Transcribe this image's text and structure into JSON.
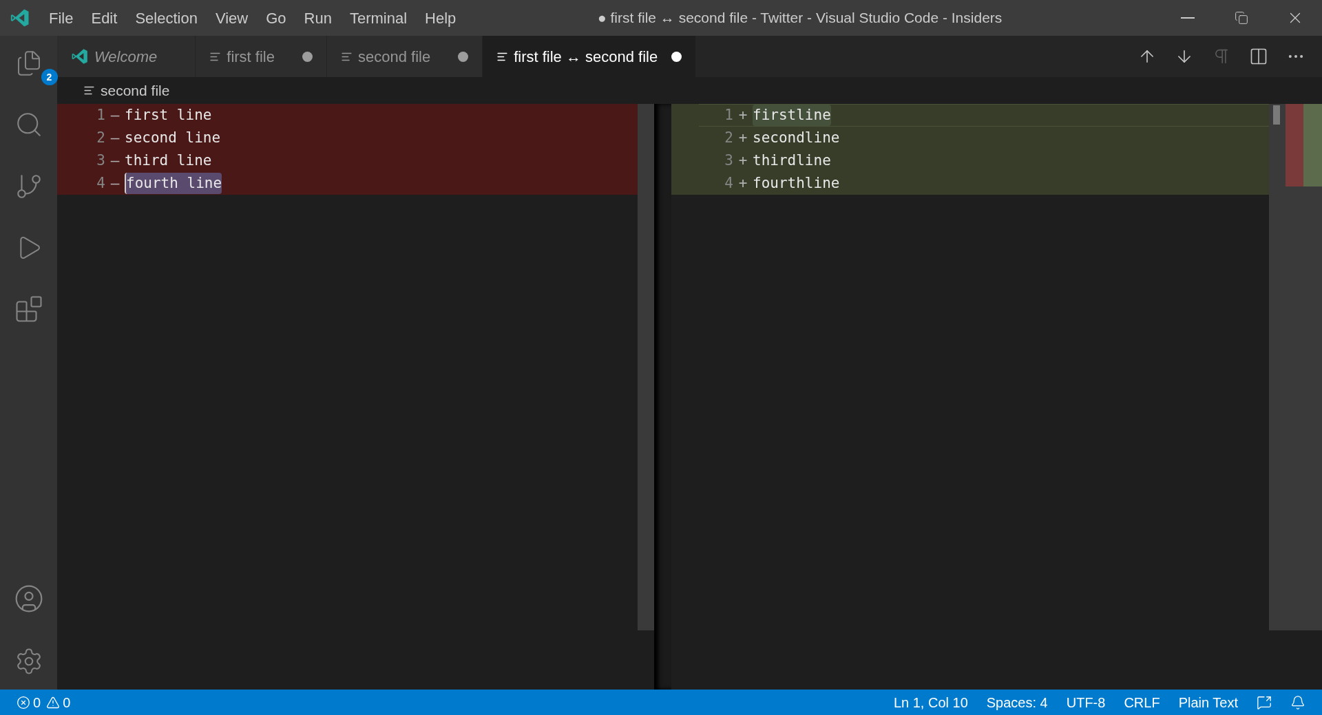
{
  "window": {
    "title": "● first file ↔ second file - Twitter - Visual Studio Code - Insiders"
  },
  "menu": [
    "File",
    "Edit",
    "Selection",
    "View",
    "Go",
    "Run",
    "Terminal",
    "Help"
  ],
  "activity_bar": {
    "explorer_badge": "2"
  },
  "tabs": [
    {
      "label": "Welcome",
      "kind": "welcome",
      "dirty": false,
      "selected": false
    },
    {
      "label": "first file",
      "kind": "file",
      "dirty": true,
      "selected": false
    },
    {
      "label": "second file",
      "kind": "file",
      "dirty": true,
      "selected": false
    },
    {
      "label": "first file ↔ second file",
      "kind": "diff",
      "dirty": true,
      "selected": true
    }
  ],
  "editor_actions": [
    {
      "kind": "up",
      "disabled": false
    },
    {
      "kind": "down",
      "disabled": false
    },
    {
      "kind": "whitespace",
      "disabled": true
    },
    {
      "kind": "split",
      "disabled": false
    },
    {
      "kind": "more",
      "disabled": false
    }
  ],
  "breadcrumb": "second file",
  "left_lines": [
    {
      "number": "1",
      "sign": "—",
      "text": "first line",
      "selected": false
    },
    {
      "number": "2",
      "sign": "—",
      "text": "second line",
      "selected": false
    },
    {
      "number": "3",
      "sign": "—",
      "text": "third line",
      "selected": false
    },
    {
      "number": "4",
      "sign": "—",
      "text": "fourth line",
      "selected": true
    }
  ],
  "right_lines": [
    {
      "number": "1",
      "sign": "+",
      "text": "firstline",
      "current": true
    },
    {
      "number": "2",
      "sign": "+",
      "text": "secondline",
      "current": false
    },
    {
      "number": "3",
      "sign": "+",
      "text": "thirdline",
      "current": false
    },
    {
      "number": "4",
      "sign": "+",
      "text": "fourthline",
      "current": false
    }
  ],
  "status_bar": {
    "errors": "0",
    "warnings": "0",
    "items": [
      "Ln 1, Col 10",
      "Spaces: 4",
      "UTF-8",
      "CRLF",
      "Plain Text"
    ]
  }
}
